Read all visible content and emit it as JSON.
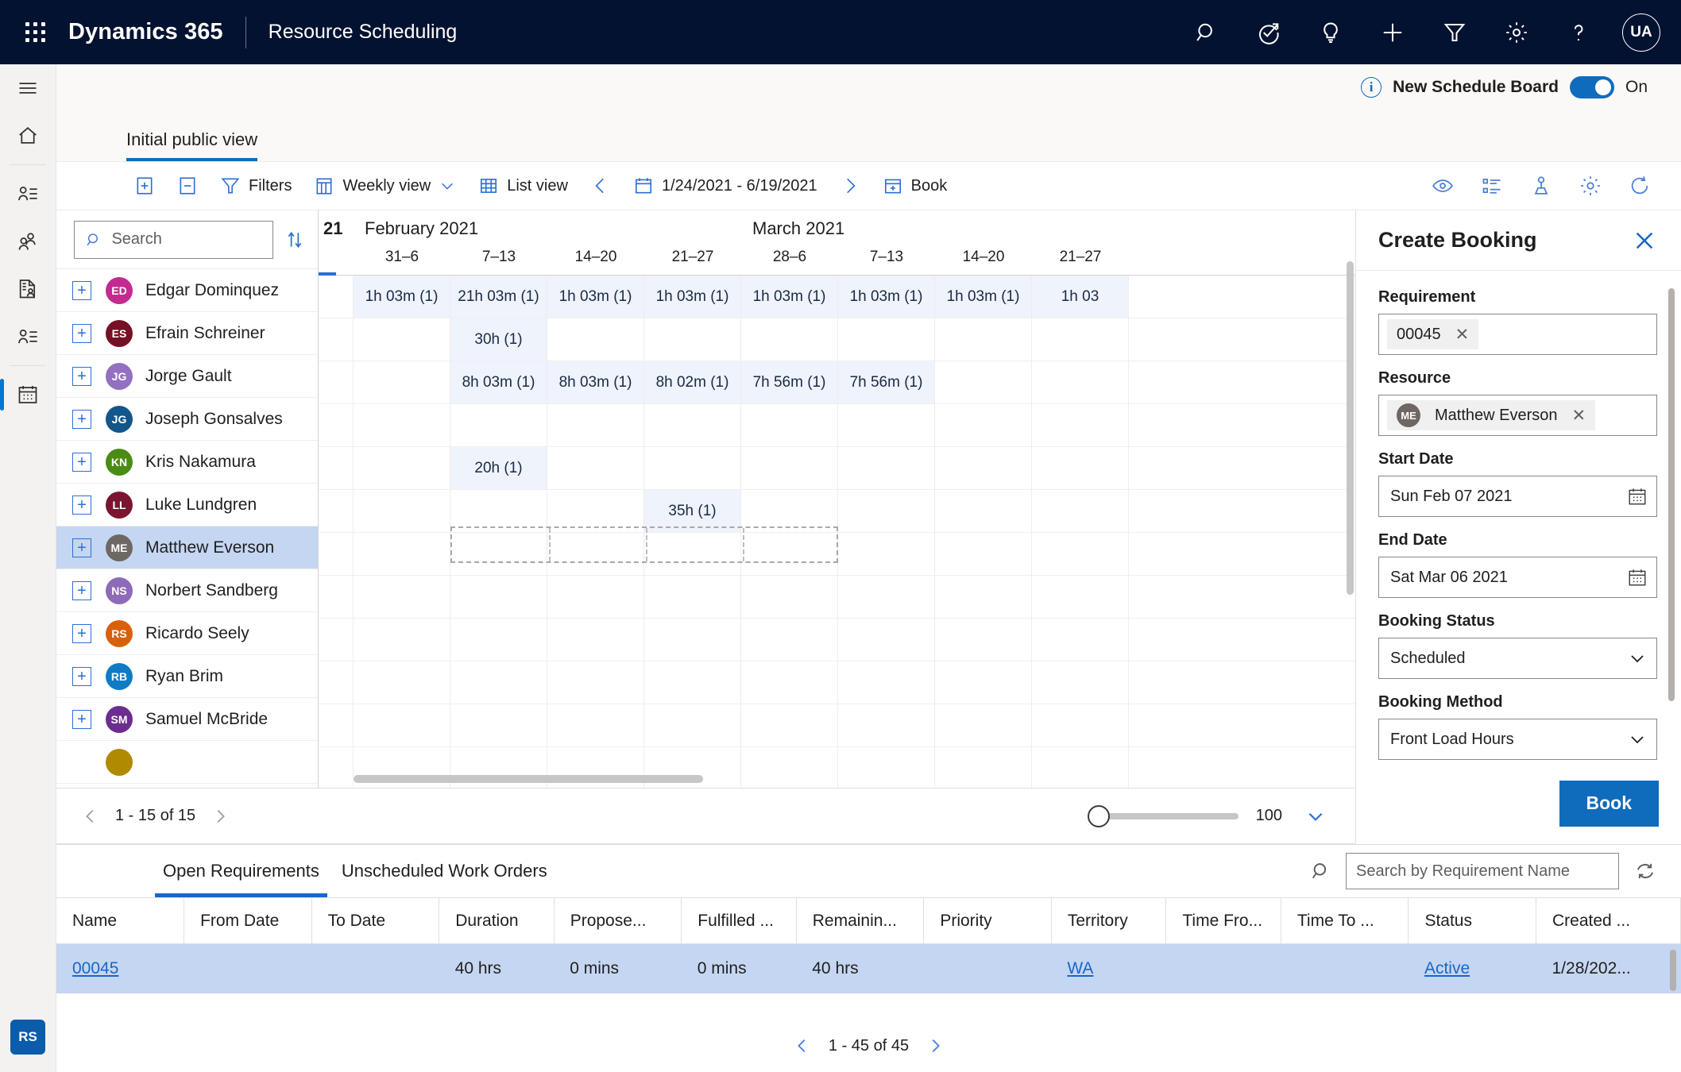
{
  "topbar": {
    "brand": "Dynamics 365",
    "app_name": "Resource Scheduling",
    "avatar_initials": "UA",
    "icons": [
      "search-icon",
      "quick-actions-icon",
      "lightbulb-icon",
      "plus-icon",
      "filter-icon",
      "gear-icon",
      "help-icon"
    ]
  },
  "new_schedule_board": {
    "label": "New Schedule Board",
    "state": "On"
  },
  "view_tab": {
    "label": "Initial public view"
  },
  "toolbar": {
    "expand_label": "",
    "collapse_label": "",
    "filters_label": "Filters",
    "weekly_view_label": "Weekly view",
    "list_view_label": "List view",
    "date_range": "1/24/2021 - 6/19/2021",
    "book_label": "Book",
    "right_icons": [
      "eye-icon",
      "details-list-icon",
      "territory-icon",
      "settings-gear-icon",
      "refresh-icon"
    ]
  },
  "resources": {
    "search_placeholder": "Search",
    "pager_text": "1 - 15 of 15",
    "zoom_value": "100",
    "items": [
      {
        "initials": "ED",
        "name": "Edgar Dominquez",
        "color": "#c42a8f",
        "selected": false
      },
      {
        "initials": "ES",
        "name": "Efrain Schreiner",
        "color": "#761026",
        "selected": false
      },
      {
        "initials": "JG",
        "name": "Jorge Gault",
        "color": "#9370c0",
        "selected": false
      },
      {
        "initials": "JG",
        "name": "Joseph Gonsalves",
        "color": "#11578b",
        "selected": false
      },
      {
        "initials": "KN",
        "name": "Kris Nakamura",
        "color": "#4a8c12",
        "selected": false
      },
      {
        "initials": "LL",
        "name": "Luke Lundgren",
        "color": "#7c1430",
        "selected": false
      },
      {
        "initials": "ME",
        "name": "Matthew Everson",
        "color": "#6e6763",
        "selected": true
      },
      {
        "initials": "NS",
        "name": "Norbert Sandberg",
        "color": "#8e6bb8",
        "selected": false
      },
      {
        "initials": "RS",
        "name": "Ricardo Seely",
        "color": "#d9600b",
        "selected": false
      },
      {
        "initials": "RB",
        "name": "Ryan Brim",
        "color": "#0f7bc4",
        "selected": false
      },
      {
        "initials": "SM",
        "name": "Samuel McBride",
        "color": "#6b2d8f",
        "selected": false
      },
      {
        "initials": "",
        "name": "",
        "color": "#b08a00",
        "selected": false
      }
    ]
  },
  "chart_data": {
    "type": "heatmap",
    "title": "Resource weekly booked hours",
    "months": [
      {
        "label": "February 2021",
        "start_col": 0,
        "span": 4
      },
      {
        "label": "March 2021",
        "start_col": 4,
        "span": 4
      }
    ],
    "partial_left_label": "21",
    "categories": [
      "31–6",
      "7–13",
      "14–20",
      "21–27",
      "28–6",
      "7–13",
      "14–20",
      "21–27"
    ],
    "series": [
      {
        "name": "Edgar Dominquez",
        "values": [
          "1h 03m (1)",
          "21h 03m (1)",
          "1h 03m (1)",
          "1h 03m (1)",
          "1h 03m (1)",
          "1h 03m (1)",
          "1h 03m (1)",
          "1h 03"
        ]
      },
      {
        "name": "Efrain Schreiner",
        "values": [
          "",
          "30h (1)",
          "",
          "",
          "",
          "",
          "",
          ""
        ]
      },
      {
        "name": "Jorge Gault",
        "values": [
          "",
          "8h 03m (1)",
          "8h 03m (1)",
          "8h 02m (1)",
          "7h 56m (1)",
          "7h 56m (1)",
          "",
          ""
        ]
      },
      {
        "name": "Joseph Gonsalves",
        "values": [
          "",
          "",
          "",
          "",
          "",
          "",
          "",
          ""
        ]
      },
      {
        "name": "Kris Nakamura",
        "values": [
          "",
          "20h (1)",
          "",
          "",
          "",
          "",
          "",
          ""
        ]
      },
      {
        "name": "Luke Lundgren",
        "values": [
          "",
          "",
          "",
          "35h (1)",
          "",
          "",
          "",
          ""
        ]
      },
      {
        "name": "Matthew Everson",
        "values": [
          "",
          "",
          "",
          "",
          "",
          "",
          "",
          ""
        ]
      },
      {
        "name": "Norbert Sandberg",
        "values": [
          "",
          "",
          "",
          "",
          "",
          "",
          "",
          ""
        ]
      },
      {
        "name": "Ricardo Seely",
        "values": [
          "",
          "",
          "",
          "",
          "",
          "",
          "",
          ""
        ]
      },
      {
        "name": "Ryan Brim",
        "values": [
          "",
          "",
          "",
          "",
          "",
          "",
          "",
          ""
        ]
      },
      {
        "name": "Samuel McBride",
        "values": [
          "",
          "",
          "",
          "",
          "",
          "",
          "",
          ""
        ]
      },
      {
        "name": "",
        "values": [
          "",
          "",
          "",
          "",
          "",
          "",
          "",
          ""
        ]
      }
    ],
    "selection_preview": {
      "row": "Matthew Everson",
      "start_col": 1,
      "span": 4
    },
    "xlabel": "",
    "ylabel": "",
    "grid": true,
    "legend": "none"
  },
  "panel": {
    "title": "Create Booking",
    "requirement_label": "Requirement",
    "requirement_value": "00045",
    "resource_label": "Resource",
    "resource_value": "Matthew Everson",
    "resource_initials": "ME",
    "start_date_label": "Start Date",
    "start_date_value": "Sun Feb 07 2021",
    "end_date_label": "End Date",
    "end_date_value": "Sat Mar 06 2021",
    "booking_status_label": "Booking Status",
    "booking_status_value": "Scheduled",
    "booking_method_label": "Booking Method",
    "booking_method_value": "Front Load Hours",
    "book_button": "Book"
  },
  "bottom": {
    "tabs": [
      {
        "label": "Open Requirements",
        "active": true
      },
      {
        "label": "Unscheduled Work Orders",
        "active": false
      }
    ],
    "search_placeholder": "Search by Requirement Name",
    "columns": [
      "Name",
      "From Date",
      "To Date",
      "Duration",
      "Propose...",
      "Fulfilled ...",
      "Remainin...",
      "Priority",
      "Territory",
      "Time Fro...",
      "Time To ...",
      "Status",
      "Created ..."
    ],
    "rows": [
      {
        "selected": true,
        "cells": [
          "00045",
          "",
          "",
          "40 hrs",
          "0 mins",
          "0 mins",
          "40 hrs",
          "",
          "WA",
          "",
          "",
          "Active",
          "1/28/202..."
        ],
        "links": [
          0,
          8,
          11
        ]
      }
    ],
    "pager_text": "1 - 45 of 45"
  },
  "rail": {
    "items": [
      "hamburger-icon",
      "home-icon",
      "accounts-icon",
      "contacts-icon",
      "work-orders-icon",
      "resources-icon",
      "schedule-board-icon"
    ],
    "user_initials": "RS"
  },
  "colors": {
    "accent": "#0f6cbd",
    "navy": "#031230",
    "selection": "#c5d6f2",
    "cell_fill": "#eef3fc"
  }
}
